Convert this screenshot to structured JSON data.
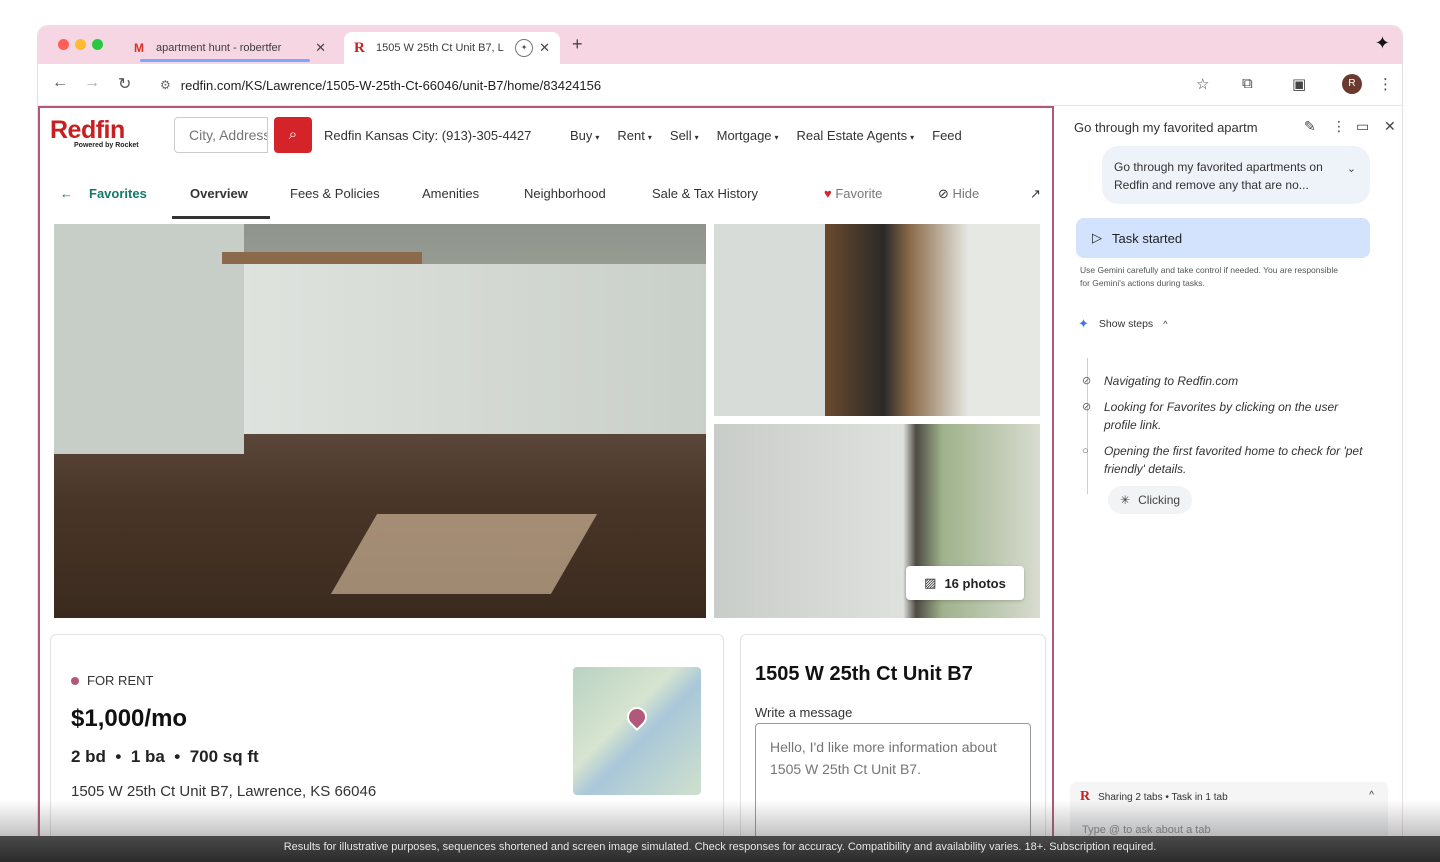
{
  "browser": {
    "tabs": [
      {
        "icon": "M",
        "title": "apartment hunt - robertfer"
      },
      {
        "icon": "R",
        "title": "1505 W 25th Ct Unit B7, L"
      }
    ],
    "url": "redfin.com/KS/Lawrence/1505-W-25th-Ct-66046/unit-B7/home/83424156",
    "avatar_initial": "R"
  },
  "site": {
    "logo": "Redfin",
    "logo_sub": "Powered by Rocket",
    "search_placeholder": "City, Address",
    "phone": "Redfin Kansas City: (913)-305-4427",
    "nav": [
      "Buy",
      "Rent",
      "Sell",
      "Mortgage",
      "Real Estate Agents",
      "Feed"
    ]
  },
  "subnav": {
    "back_label": "Favorites",
    "items": [
      "Overview",
      "Fees & Policies",
      "Amenities",
      "Neighborhood",
      "Sale & Tax History"
    ],
    "favorite": "Favorite",
    "hide": "Hide"
  },
  "photos": {
    "count_label": "16 photos"
  },
  "listing": {
    "status": "FOR RENT",
    "price": "$1,000/mo",
    "beds": "2 bd",
    "baths": "1 ba",
    "sqft": "700 sq ft",
    "address_full": "1505 W 25th Ct Unit B7, Lawrence, KS 66046",
    "address_title": "1505 W 25th Ct Unit B7",
    "message_label": "Write a message",
    "message_placeholder": "Hello, I'd like more information about 1505 W 25th Ct Unit B7."
  },
  "panel": {
    "title": "Go through my favorited apartm",
    "prompt": "Go through my favorited apartments on Redfin and remove any that are no...",
    "task_status": "Task started",
    "disclaimer": "Use Gemini carefully and take control if needed. You are responsible for Gemini's actions during tasks.",
    "show_steps": "Show steps",
    "steps": [
      "Navigating to Redfin.com",
      "Looking for Favorites by clicking on the user profile link.",
      "Opening the first favorited home to check for 'pet friendly' details."
    ],
    "current_action": "Clicking",
    "sharing": "Sharing 2 tabs • Task in 1 tab",
    "ask_placeholder": "Type @ to ask about a tab"
  },
  "footer": "Results for illustrative purposes, sequences shortened and screen image simulated. Check responses for accuracy. Compatibility and availability varies. 18+. Subscription required."
}
